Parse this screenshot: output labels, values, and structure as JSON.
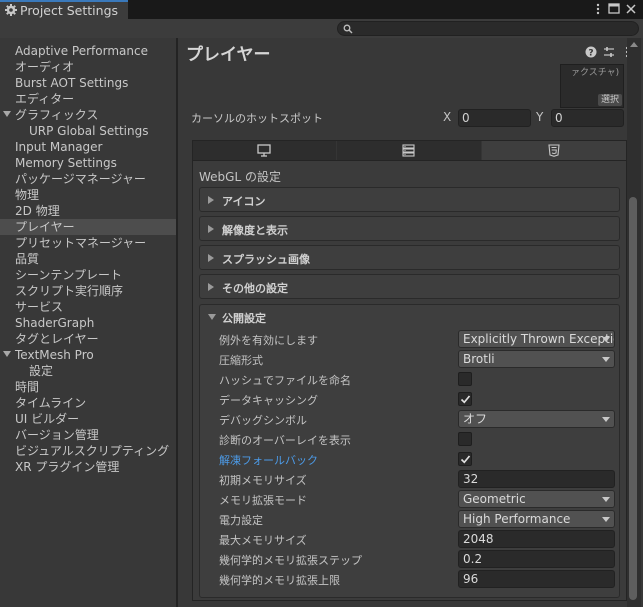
{
  "window": {
    "tab_title": "Project Settings",
    "tab_icon": "gear-icon",
    "search": {
      "value": "",
      "placeholder": ""
    }
  },
  "sidebar": {
    "items": [
      {
        "label": "Adaptive Performance",
        "indent": 0,
        "expandable": false,
        "selected": false
      },
      {
        "label": "オーディオ",
        "indent": 0,
        "expandable": false,
        "selected": false
      },
      {
        "label": "Burst AOT Settings",
        "indent": 0,
        "expandable": false,
        "selected": false
      },
      {
        "label": "エディター",
        "indent": 0,
        "expandable": false,
        "selected": false
      },
      {
        "label": "グラフィックス",
        "indent": 0,
        "expandable": true,
        "selected": false
      },
      {
        "label": "URP Global Settings",
        "indent": 1,
        "expandable": false,
        "selected": false
      },
      {
        "label": "Input Manager",
        "indent": 0,
        "expandable": false,
        "selected": false
      },
      {
        "label": "Memory Settings",
        "indent": 0,
        "expandable": false,
        "selected": false
      },
      {
        "label": "パッケージマネージャー",
        "indent": 0,
        "expandable": false,
        "selected": false
      },
      {
        "label": "物理",
        "indent": 0,
        "expandable": false,
        "selected": false
      },
      {
        "label": "2D 物理",
        "indent": 0,
        "expandable": false,
        "selected": false
      },
      {
        "label": "プレイヤー",
        "indent": 0,
        "expandable": false,
        "selected": true
      },
      {
        "label": "プリセットマネージャー",
        "indent": 0,
        "expandable": false,
        "selected": false
      },
      {
        "label": "品質",
        "indent": 0,
        "expandable": false,
        "selected": false
      },
      {
        "label": "シーンテンプレート",
        "indent": 0,
        "expandable": false,
        "selected": false
      },
      {
        "label": "スクリプト実行順序",
        "indent": 0,
        "expandable": false,
        "selected": false
      },
      {
        "label": "サービス",
        "indent": 0,
        "expandable": false,
        "selected": false
      },
      {
        "label": "ShaderGraph",
        "indent": 0,
        "expandable": false,
        "selected": false
      },
      {
        "label": "タグとレイヤー",
        "indent": 0,
        "expandable": false,
        "selected": false
      },
      {
        "label": "TextMesh Pro",
        "indent": 0,
        "expandable": true,
        "selected": false
      },
      {
        "label": "設定",
        "indent": 1,
        "expandable": false,
        "selected": false
      },
      {
        "label": "時間",
        "indent": 0,
        "expandable": false,
        "selected": false
      },
      {
        "label": "タイムライン",
        "indent": 0,
        "expandable": false,
        "selected": false
      },
      {
        "label": "UI ビルダー",
        "indent": 0,
        "expandable": false,
        "selected": false
      },
      {
        "label": "バージョン管理",
        "indent": 0,
        "expandable": false,
        "selected": false
      },
      {
        "label": "ビジュアルスクリプティング",
        "indent": 0,
        "expandable": false,
        "selected": false
      },
      {
        "label": "XR プラグイン管理",
        "indent": 0,
        "expandable": false,
        "selected": false
      }
    ]
  },
  "main": {
    "title": "プレイヤー",
    "header_icons": [
      "help-icon",
      "presets-icon",
      "more-options-icon"
    ],
    "cursor_preview": {
      "text": "ァクスチャ)",
      "select_label": "選択"
    },
    "cursor_hotspot": {
      "label": "カーソルのホットスポット",
      "x_label": "X",
      "x_value": "0",
      "y_label": "Y",
      "y_value": "0"
    },
    "platform_tabs": [
      {
        "icon": "monitor-icon",
        "active": false
      },
      {
        "icon": "server-icon",
        "active": false
      },
      {
        "icon": "html5-icon",
        "active": true
      }
    ],
    "webgl_title": "WebGL の設定",
    "sections": [
      {
        "label": "アイコン"
      },
      {
        "label": "解像度と表示"
      },
      {
        "label": "スプラッシュ画像"
      },
      {
        "label": "その他の設定"
      }
    ],
    "publishing": {
      "label": "公開設定",
      "rows": [
        {
          "label": "例外を有効にします",
          "type": "dropdown",
          "value": "Explicitly Thrown Exceptions Only",
          "link": false
        },
        {
          "label": "圧縮形式",
          "type": "dropdown",
          "value": "Brotli",
          "link": false
        },
        {
          "label": "ハッシュでファイルを命名",
          "type": "checkbox",
          "checked": false,
          "link": false
        },
        {
          "label": "データキャッシング",
          "type": "checkbox",
          "checked": true,
          "link": false
        },
        {
          "label": "デバッグシンボル",
          "type": "dropdown",
          "value": "オフ",
          "link": false
        },
        {
          "label": "診断のオーバーレイを表示",
          "type": "checkbox",
          "checked": false,
          "link": false
        },
        {
          "label": "解凍フォールバック",
          "type": "checkbox",
          "checked": true,
          "link": true
        },
        {
          "label": "初期メモリサイズ",
          "type": "text",
          "value": "32",
          "link": false
        },
        {
          "label": "メモリ拡張モード",
          "type": "dropdown",
          "value": "Geometric",
          "link": false
        },
        {
          "label": "電力設定",
          "type": "dropdown",
          "value": "High Performance",
          "link": false
        },
        {
          "label": "最大メモリサイズ",
          "type": "text",
          "value": "2048",
          "link": false
        },
        {
          "label": "幾何学的メモリ拡張ステップ",
          "type": "text",
          "value": "0.2",
          "link": false
        },
        {
          "label": "幾何学的メモリ拡張上限",
          "type": "text",
          "value": "96",
          "link": false
        }
      ]
    }
  },
  "colors": {
    "accent": "#3a79bb",
    "link": "#4c9be8"
  }
}
